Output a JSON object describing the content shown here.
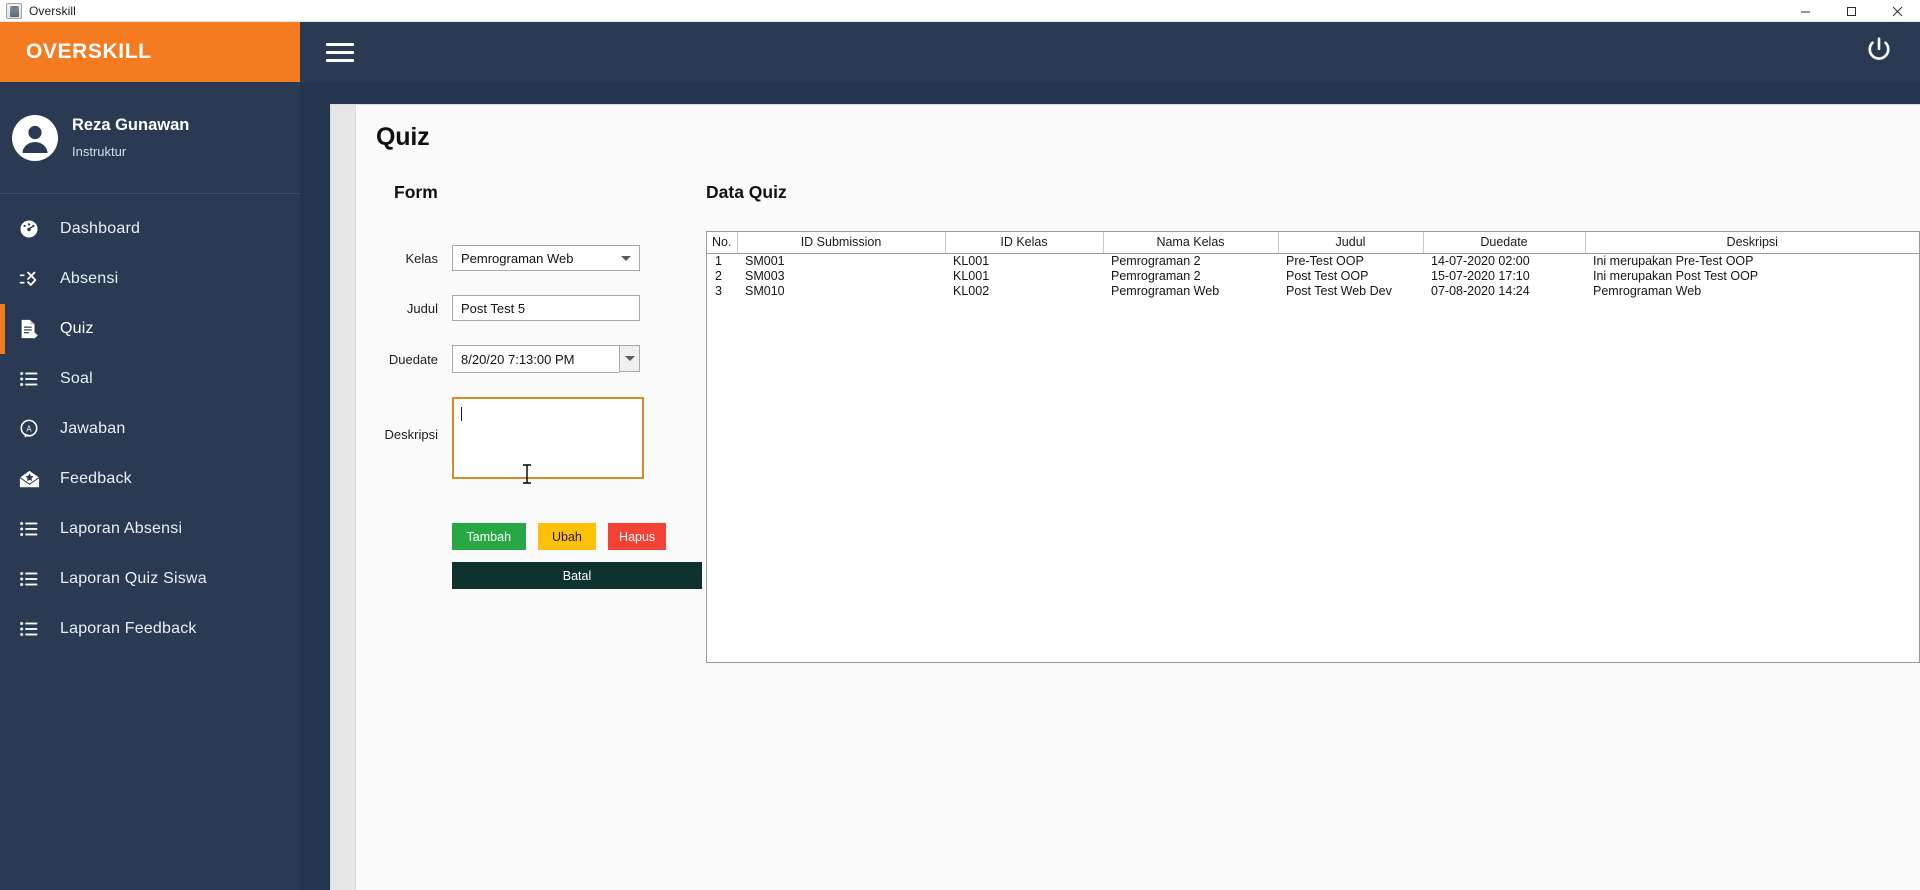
{
  "window": {
    "title": "Overskill",
    "app_icon": "java-coffee-cup-icon",
    "controls": {
      "minimize": "minimize-icon",
      "maximize": "maximize-icon",
      "close": "close-icon"
    }
  },
  "sidebar": {
    "brand": "OVERSKILL",
    "profile": {
      "name": "Reza Gunawan",
      "role": "Instruktur",
      "avatar_icon": "user-avatar-icon"
    },
    "items": [
      {
        "label": "Dashboard",
        "icon": "dashboard-gauge-icon",
        "active": false
      },
      {
        "label": "Absensi",
        "icon": "attendance-check-icon",
        "active": false
      },
      {
        "label": "Quiz",
        "icon": "quiz-document-icon",
        "active": true
      },
      {
        "label": "Soal",
        "icon": "list-icon",
        "active": false
      },
      {
        "label": "Jawaban",
        "icon": "answer-bubble-icon",
        "active": false
      },
      {
        "label": "Feedback",
        "icon": "envelope-star-icon",
        "active": false
      },
      {
        "label": "Laporan Absensi",
        "icon": "list-icon",
        "active": false
      },
      {
        "label": "Laporan Quiz Siswa",
        "icon": "list-icon",
        "active": false
      },
      {
        "label": "Laporan Feedback",
        "icon": "list-icon",
        "active": false
      }
    ]
  },
  "topbar": {
    "menu_icon": "hamburger-menu-icon",
    "power_icon": "power-off-icon"
  },
  "page": {
    "title": "Quiz",
    "form": {
      "heading": "Form",
      "fields": {
        "kelas": {
          "label": "Kelas",
          "value": "Pemrograman Web",
          "control": "combobox"
        },
        "judul": {
          "label": "Judul",
          "value": "Post Test 5",
          "control": "text"
        },
        "duedate": {
          "label": "Duedate",
          "value": "8/20/20 7:13:00 PM",
          "control": "spinner"
        },
        "deskripsi": {
          "label": "Deskripsi",
          "value": "",
          "control": "textarea"
        }
      },
      "buttons": {
        "tambah": "Tambah",
        "ubah": "Ubah",
        "hapus": "Hapus",
        "batal": "Batal"
      },
      "colors": {
        "tambah": "#28a745",
        "ubah": "#ffc107",
        "hapus": "#f44336",
        "batal": "#0e332f",
        "focus_border": "#d98c23",
        "brand_orange": "#f47b20",
        "sidebar_navy": "#2b3a53"
      }
    },
    "table": {
      "heading": "Data Quiz",
      "columns": [
        "No.",
        "ID Submission",
        "ID Kelas",
        "Nama Kelas",
        "Judul",
        "Duedate",
        "Deskripsi"
      ],
      "rows": [
        {
          "no": "1",
          "id_submission": "SM001",
          "id_kelas": "KL001",
          "nama_kelas": "Pemrograman 2",
          "judul": "Pre-Test OOP",
          "duedate": "14-07-2020 02:00",
          "deskripsi": "Ini merupakan Pre-Test OOP"
        },
        {
          "no": "2",
          "id_submission": "SM003",
          "id_kelas": "KL001",
          "nama_kelas": "Pemrograman 2",
          "judul": "Post Test OOP",
          "duedate": "15-07-2020 17:10",
          "deskripsi": "Ini merupakan Post Test OOP"
        },
        {
          "no": "3",
          "id_submission": "SM010",
          "id_kelas": "KL002",
          "nama_kelas": "Pemrograman Web",
          "judul": "Post Test Web Dev",
          "duedate": "07-08-2020 14:24",
          "deskripsi": "Pemrograman Web"
        }
      ]
    }
  }
}
